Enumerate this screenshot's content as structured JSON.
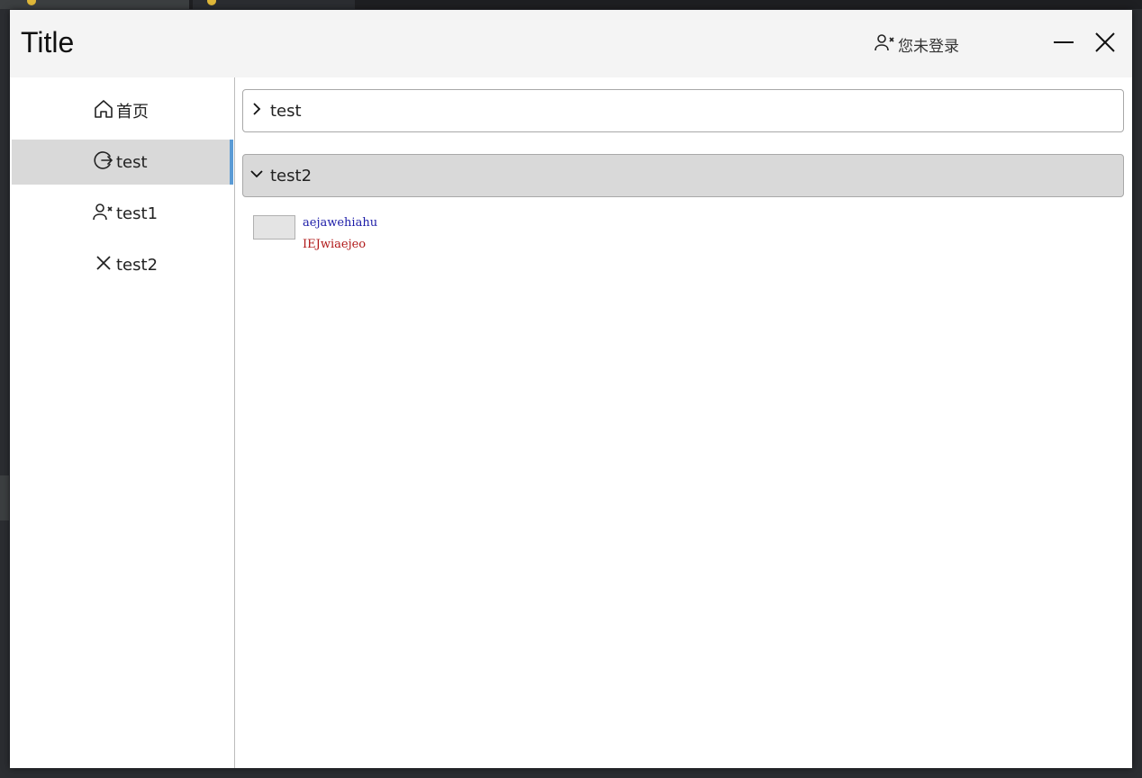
{
  "window": {
    "title": "Title",
    "login_status": "您未登录",
    "controls": {
      "minimize_icon": "minimize-icon",
      "close_icon": "close-icon"
    }
  },
  "sidebar": {
    "items": [
      {
        "label": "首页",
        "icon": "home-icon",
        "active": false
      },
      {
        "label": "test",
        "icon": "logout-icon",
        "active": true
      },
      {
        "label": "test1",
        "icon": "user-remove-icon",
        "active": false
      },
      {
        "label": "test2",
        "icon": "close-icon",
        "active": false
      }
    ]
  },
  "content": {
    "expanders": [
      {
        "label": "test",
        "expanded": false,
        "icon": "chevron-right-icon"
      },
      {
        "label": "test2",
        "expanded": true,
        "icon": "chevron-down-icon"
      }
    ],
    "entry": {
      "line1": "aejawehiahu",
      "line2": "IEJwiaejeo"
    }
  },
  "colors": {
    "accent": "#5b9bd5",
    "selected_bg": "#d9d9d9",
    "titlebar_bg": "#f4f4f4",
    "entry_line1": "#1c1ca8",
    "entry_line2": "#b01818"
  }
}
